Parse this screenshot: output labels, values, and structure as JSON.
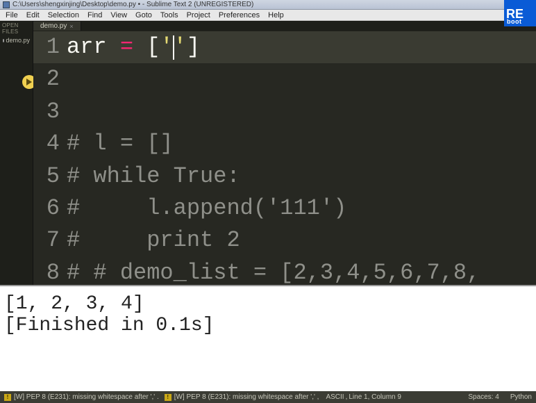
{
  "titlebar": {
    "path": "C:\\Users\\shengxinjing\\Desktop\\demo.py • - Sublime Text 2 (UNREGISTERED)"
  },
  "menubar": {
    "items": [
      "File",
      "Edit",
      "Selection",
      "Find",
      "View",
      "Goto",
      "Tools",
      "Project",
      "Preferences",
      "Help"
    ]
  },
  "sidebar": {
    "section_label": "OPEN FILES",
    "file": "demo.py"
  },
  "tabs": {
    "active": "demo.py"
  },
  "code": {
    "lines": [
      {
        "n": "1",
        "segments": [
          {
            "t": "arr ",
            "c": "tok-var"
          },
          {
            "t": "=",
            "c": "tok-op"
          },
          {
            "t": " [",
            "c": "tok-pun"
          },
          {
            "t": "'",
            "c": "tok-str"
          },
          {
            "cursor": true
          },
          {
            "t": "'",
            "c": "tok-str"
          },
          {
            "t": "]",
            "c": "tok-pun"
          }
        ],
        "current": true
      },
      {
        "n": "2",
        "segments": []
      },
      {
        "n": "3",
        "segments": []
      },
      {
        "n": "4",
        "segments": [
          {
            "t": "# l = []",
            "c": "tok-cmt"
          }
        ]
      },
      {
        "n": "5",
        "segments": [
          {
            "t": "# while True:",
            "c": "tok-cmt"
          }
        ]
      },
      {
        "n": "6",
        "segments": [
          {
            "t": "#     l.append('111')",
            "c": "tok-cmt"
          }
        ]
      },
      {
        "n": "7",
        "segments": [
          {
            "t": "#     print 2",
            "c": "tok-cmt"
          }
        ]
      },
      {
        "n": "8",
        "segments": [
          {
            "t": "# # demo_list = [2,3,4,5,6,7,8,",
            "c": "tok-cmt"
          }
        ]
      }
    ]
  },
  "output": {
    "lines": [
      "[1, 2, 3, 4]",
      "[Finished in 0.1s]"
    ]
  },
  "statusbar": {
    "lint1": "[W] PEP 8 (E231): missing whitespace after ',' .",
    "lint2": "[W] PEP 8 (E231): missing whitespace after ',' ,",
    "encoding": "ASCII",
    "position": "Line 1, Column 9",
    "spaces": "Spaces: 4",
    "syntax": "Python"
  },
  "overlay": {
    "big": "RE",
    "small": "boot"
  }
}
